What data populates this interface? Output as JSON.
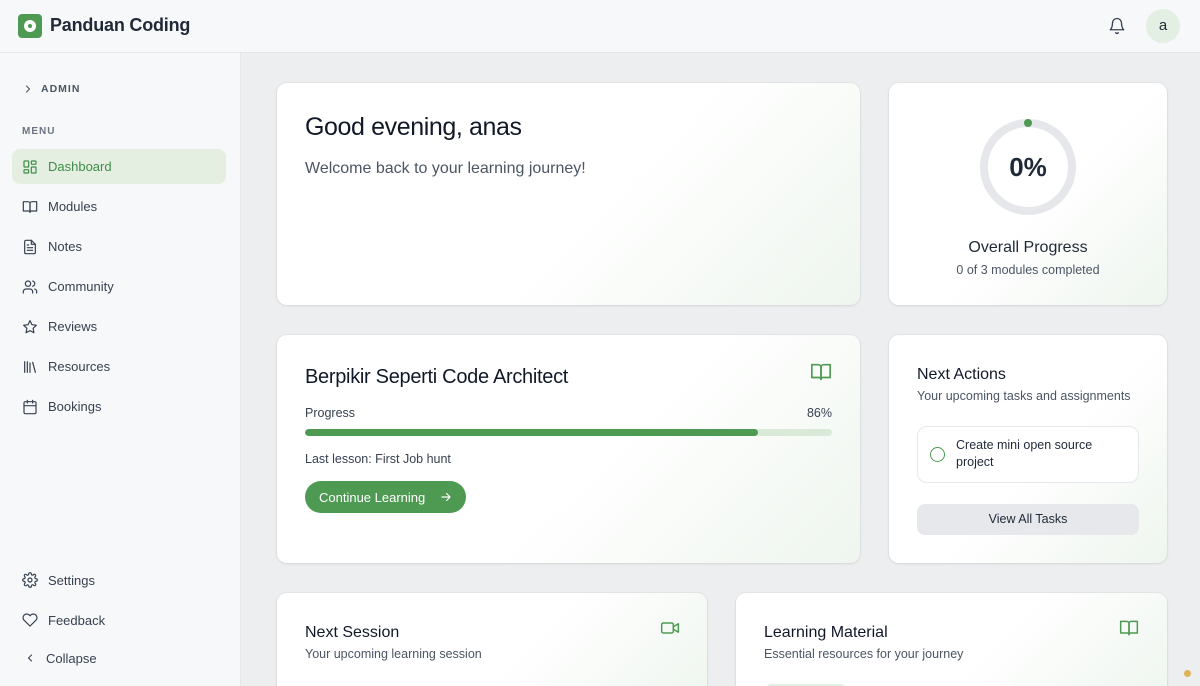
{
  "header": {
    "brand": "Panduan Coding",
    "avatar_initial": "a"
  },
  "sidebar": {
    "admin_label": "ADMIN",
    "menu_label": "MENU",
    "items": [
      {
        "label": "Dashboard",
        "icon": "dashboard-icon",
        "active": true
      },
      {
        "label": "Modules",
        "icon": "book-icon"
      },
      {
        "label": "Notes",
        "icon": "file-text-icon"
      },
      {
        "label": "Community",
        "icon": "users-icon"
      },
      {
        "label": "Reviews",
        "icon": "star-icon"
      },
      {
        "label": "Resources",
        "icon": "library-icon"
      },
      {
        "label": "Bookings",
        "icon": "calendar-icon"
      }
    ],
    "bottom": [
      {
        "label": "Settings",
        "icon": "gear-icon"
      },
      {
        "label": "Feedback",
        "icon": "heart-icon"
      },
      {
        "label": "Collapse",
        "icon": "chevron-left-icon"
      }
    ]
  },
  "greeting": {
    "title": "Good evening, anas",
    "subtitle": "Welcome back to your learning journey!"
  },
  "overall": {
    "percent_text": "0%",
    "percent": 0,
    "title": "Overall Progress",
    "subtitle": "0 of 3 modules completed"
  },
  "course": {
    "title": "Berpikir Seperti Code Architect",
    "progress_label": "Progress",
    "progress_text": "86%",
    "progress": 86,
    "last_lesson": "Last lesson: First Job hunt",
    "continue_label": "Continue Learning"
  },
  "next_actions": {
    "title": "Next Actions",
    "subtitle": "Your upcoming tasks and assignments",
    "task": "Create mini open source project",
    "view_all": "View All Tasks"
  },
  "next_session": {
    "title": "Next Session",
    "subtitle": "Your upcoming learning session"
  },
  "learning_material": {
    "title": "Learning Material",
    "subtitle": "Essential resources for your journey"
  },
  "colors": {
    "accent": "#4e9a53",
    "active_bg": "#e4efe2",
    "ring_track": "#e5e7eb"
  }
}
